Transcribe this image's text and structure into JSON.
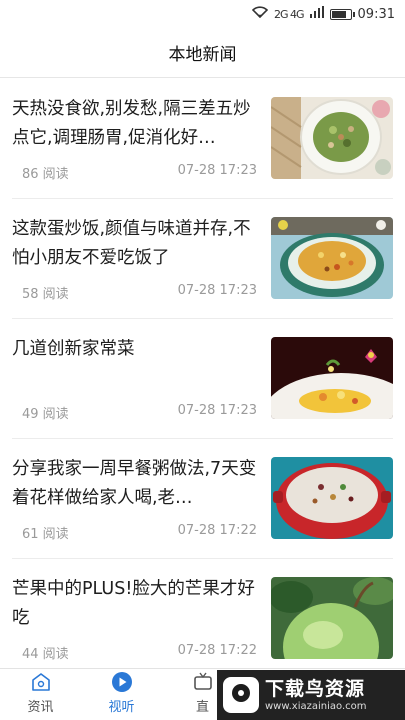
{
  "status": {
    "signal": "2G 4G",
    "time": "09:31",
    "battery_level": 0.85
  },
  "header": {
    "title": "本地新闻"
  },
  "news": [
    {
      "title": "天热没食欲,别发愁,隔三差五炒点它,调理肠胃,促消化好…",
      "reads": "86 阅读",
      "time": "07-28 17:23",
      "thumb": "stir-fry-greens"
    },
    {
      "title": "这款蛋炒饭,颜值与味道并存,不怕小朋友不爱吃饭了",
      "reads": "58 阅读",
      "time": "07-28 17:23",
      "thumb": "egg-fried-rice"
    },
    {
      "title": "几道创新家常菜",
      "reads": "49 阅读",
      "time": "07-28 17:23",
      "thumb": "plated-dish"
    },
    {
      "title": "分享我家一周早餐粥做法,7天变着花样做给家人喝,老…",
      "reads": "61 阅读",
      "time": "07-28 17:22",
      "thumb": "congee-pot"
    },
    {
      "title": "芒果中的PLUS!脸大的芒果才好吃",
      "reads": "44 阅读",
      "time": "07-28 17:22",
      "thumb": "mango"
    }
  ],
  "tabs": [
    {
      "label": "资讯",
      "icon": "home-icon"
    },
    {
      "label": "视听",
      "icon": "play-icon",
      "active": true
    },
    {
      "label": "直",
      "icon": "tv-icon"
    }
  ],
  "watermark": {
    "brand": "下载鸟资源",
    "url": "www.xiazainiao.com"
  }
}
